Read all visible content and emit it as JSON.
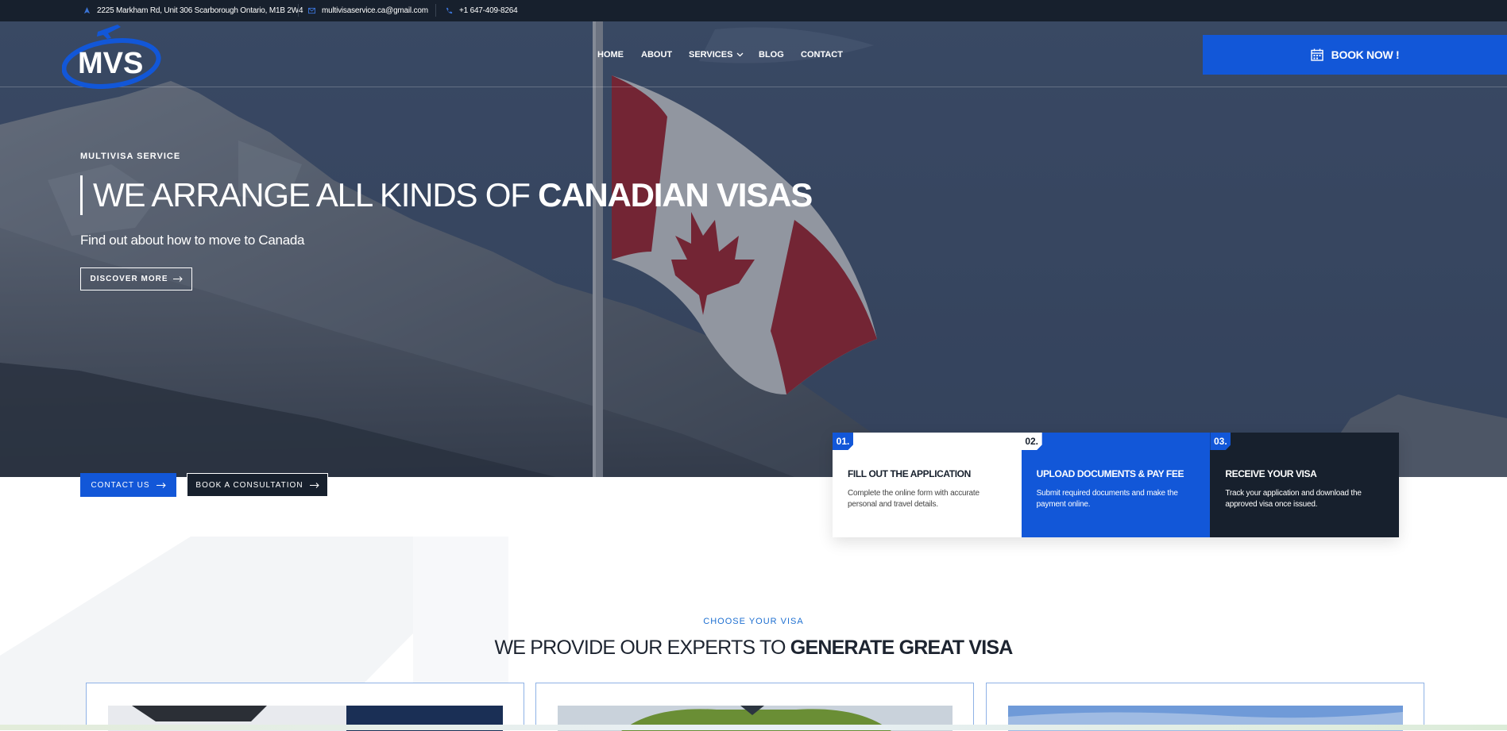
{
  "topbar": {
    "address": "2225 Markham Rd, Unit 306 Scarborough Ontario, M1B 2W4",
    "email": "multivisaservice.ca@gmail.com",
    "phone": "+1 647-409-8264"
  },
  "logo": {
    "text": "MVS"
  },
  "nav": {
    "items": [
      "HOME",
      "ABOUT",
      "SERVICES",
      "BLOG",
      "CONTACT"
    ]
  },
  "book_now": {
    "label": "BOOK NOW !"
  },
  "hero": {
    "eyebrow": "MULTIVISA SERVICE",
    "headline_light": "WE ARRANGE ALL KINDS OF ",
    "headline_bold": "CANADIAN VISAS",
    "subtitle": "Find out about how to move to Canada",
    "discover_label": "DISCOVER MORE"
  },
  "cta": {
    "contact_label": "CONTACT US",
    "consult_label": "BOOK A CONSULTATION"
  },
  "steps": [
    {
      "num": "01.",
      "title": "FILL OUT THE APPLICATION",
      "desc": "Complete the online form with accurate personal and travel details."
    },
    {
      "num": "02.",
      "title": "UPLOAD DOCUMENTS & PAY FEE",
      "desc": "Submit required documents and make the payment online."
    },
    {
      "num": "03.",
      "title": "RECEIVE YOUR VISA",
      "desc": "Track your application and download the approved visa once issued."
    }
  ],
  "section": {
    "eyebrow": "CHOOSE YOUR VISA",
    "title_light": "WE PROVIDE OUR EXPERTS TO ",
    "title_bold": "GENERATE GREAT VISA"
  },
  "colors": {
    "accent": "#1257d8",
    "dark": "#17202d",
    "hero_overlay": "#46566f",
    "flag_red": "#a8232b"
  }
}
